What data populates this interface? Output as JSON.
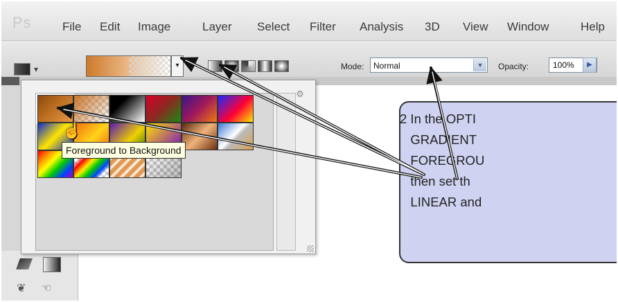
{
  "app": {
    "logo_text": "Ps"
  },
  "menu": {
    "items": [
      "File",
      "Edit",
      "Image",
      "Layer",
      "Select",
      "Filter",
      "Analysis",
      "3D",
      "View",
      "Window",
      "Help"
    ]
  },
  "options_bar": {
    "mode_label": "Mode:",
    "mode_value": "Normal",
    "opacity_label": "Opacity:",
    "opacity_value": "100%",
    "gradient_types": [
      "linear",
      "radial",
      "angle",
      "reflected",
      "diamond"
    ]
  },
  "gradient_picker": {
    "swatches": [
      "Foreground to Background",
      "Foreground to Transparent",
      "Black, White",
      "Red, Green",
      "Violet, Orange",
      "Blue, Red, Yellow",
      "Blue, Yellow, Blue",
      "Orange, Yellow, Orange",
      "Violet, Green, Orange",
      "Yellow, Violet, Orange, Blue",
      "Copper",
      "Chrome",
      "Spectrum",
      "Transparent Rainbow",
      "Transparent Stripes",
      "Neutral Density"
    ],
    "tooltip": "Foreground to Background"
  },
  "callout": {
    "text": "2 In the OPTI\n   GRADIENT\n   FOREGROU\n   then set th\n   LINEAR and"
  },
  "colors": {
    "callout_bg": "#cfd3f1",
    "gradient_start": "#cd7a2c",
    "tooltip_bg": "#ffffe1"
  }
}
